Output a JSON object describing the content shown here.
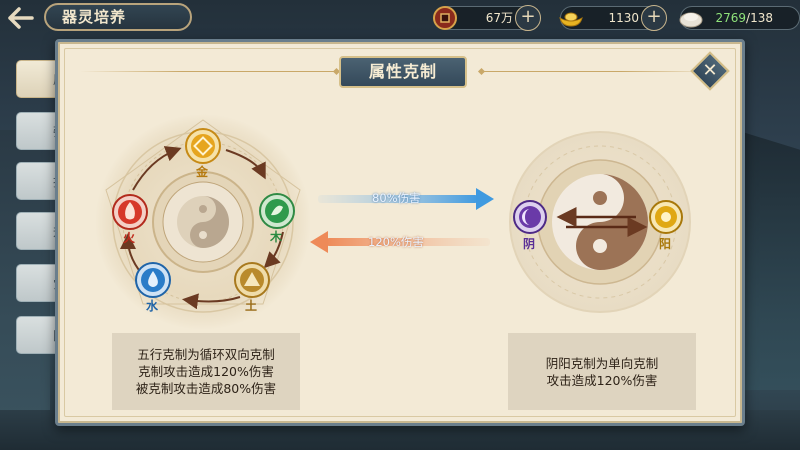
{
  "header": {
    "title": "器灵培养",
    "back_icon": "back-arrow-icon"
  },
  "resources": [
    {
      "icon": "copper-coin-icon",
      "value": "67万"
    },
    {
      "icon": "gold-ingot-icon",
      "value": "1130"
    },
    {
      "icon": "stamina-bun-icon",
      "value": "2769",
      "max": "/138"
    }
  ],
  "panel": {
    "title": "属性克制",
    "close_icon": "close-x-icon"
  },
  "five_elements": {
    "nodes": [
      {
        "label": "金",
        "color": "#e0a21c"
      },
      {
        "label": "木",
        "color": "#2f9a4c"
      },
      {
        "label": "土",
        "color": "#b78a2c"
      },
      {
        "label": "水",
        "color": "#2a7cc8"
      },
      {
        "label": "火",
        "color": "#d6382a"
      }
    ],
    "description": [
      "五行克制为循环双向克制",
      "克制攻击造成120%伤害",
      "被克制攻击造成80%伤害"
    ]
  },
  "arrows": {
    "forward_label": "80%伤害",
    "backward_label": "120%伤害"
  },
  "yin_yang": {
    "yin_label": "阴",
    "yang_label": "阳",
    "yin_color": "#6a3aa8",
    "yang_color": "#d9a514",
    "description": [
      "阴阳克制为单向克制",
      "攻击造成120%伤害"
    ]
  },
  "colors": {
    "panel_bg": "#f3ead6",
    "accent_gold": "#c9a868",
    "title_bg": "#3e5566"
  }
}
